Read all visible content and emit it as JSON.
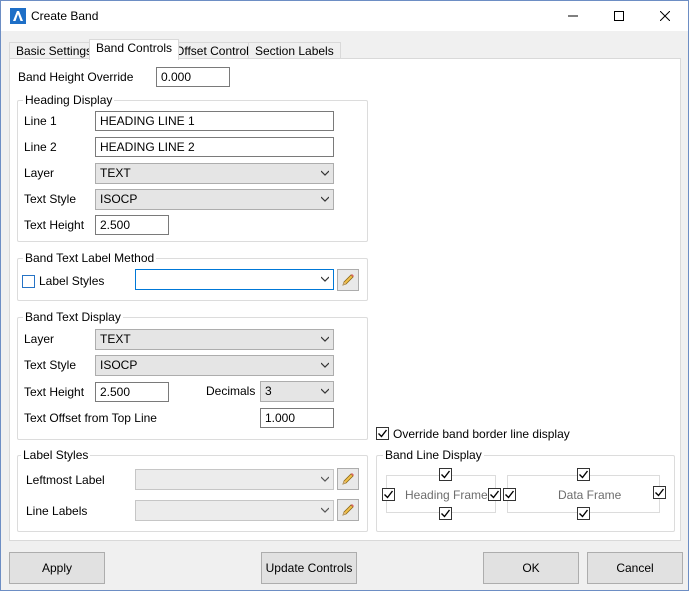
{
  "window": {
    "title": "Create Band"
  },
  "tabs": [
    {
      "label": "Basic Settings"
    },
    {
      "label": "Band Controls"
    },
    {
      "label": "Offset Controls"
    },
    {
      "label": "Section Labels"
    }
  ],
  "band_height_override": {
    "label": "Band Height Override",
    "value": "0.000"
  },
  "heading_display": {
    "title": "Heading Display",
    "line1": {
      "label": "Line 1",
      "value": "HEADING LINE 1"
    },
    "line2": {
      "label": "Line 2",
      "value": "HEADING LINE 2"
    },
    "layer": {
      "label": "Layer",
      "value": "TEXT"
    },
    "text_style": {
      "label": "Text Style",
      "value": "ISOCP"
    },
    "text_height": {
      "label": "Text Height",
      "value": "2.500"
    }
  },
  "band_text_label_method": {
    "title": "Band Text Label Method",
    "label_styles": {
      "label": "Label Styles",
      "checked": false,
      "value": ""
    }
  },
  "band_text_display": {
    "title": "Band Text Display",
    "layer": {
      "label": "Layer",
      "value": "TEXT"
    },
    "text_style": {
      "label": "Text Style",
      "value": "ISOCP"
    },
    "text_height": {
      "label": "Text Height",
      "value": "2.500"
    },
    "decimals": {
      "label": "Decimals",
      "value": "3"
    },
    "text_offset": {
      "label": "Text Offset from Top Line",
      "value": "1.000"
    }
  },
  "label_styles": {
    "title": "Label Styles",
    "leftmost": {
      "label": "Leftmost Label",
      "value": ""
    },
    "line_labels": {
      "label": "Line Labels",
      "value": ""
    }
  },
  "override_border": {
    "label": "Override band border line display",
    "checked": true
  },
  "band_line_display": {
    "title": "Band Line Display",
    "heading_frame": {
      "label": "Heading Frame",
      "top": true,
      "left": true,
      "right": true,
      "bottom": true
    },
    "data_frame": {
      "label": "Data Frame",
      "top": true,
      "left": true,
      "right": true,
      "bottom": true
    }
  },
  "buttons": {
    "apply": "Apply",
    "update": "Update Controls",
    "ok": "OK",
    "cancel": "Cancel"
  },
  "icons": {
    "app": "civil-band-app-icon",
    "pencil": "pencil-icon",
    "minimize": "minimize-icon",
    "maximize": "maximize-icon",
    "close": "close-icon"
  }
}
